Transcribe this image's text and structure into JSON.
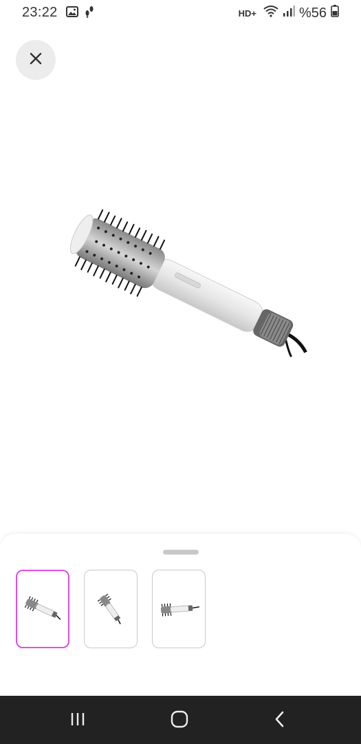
{
  "status_bar": {
    "time": "23:22",
    "network_label": "HD+",
    "battery_text": "%56"
  },
  "icons": {
    "close": "close-icon",
    "gallery": "image-icon",
    "steps": "footsteps-icon",
    "wifi": "wifi-icon",
    "signal": "signal-icon",
    "battery": "battery-icon",
    "recents": "recents-icon",
    "home": "home-icon",
    "back": "back-icon"
  },
  "product": {
    "image": "hot-air-brush-image"
  },
  "thumbnails": {
    "count": 3,
    "selected_index": 0
  },
  "colors": {
    "selected_border": "#e04de6",
    "nav_background": "#222222"
  }
}
